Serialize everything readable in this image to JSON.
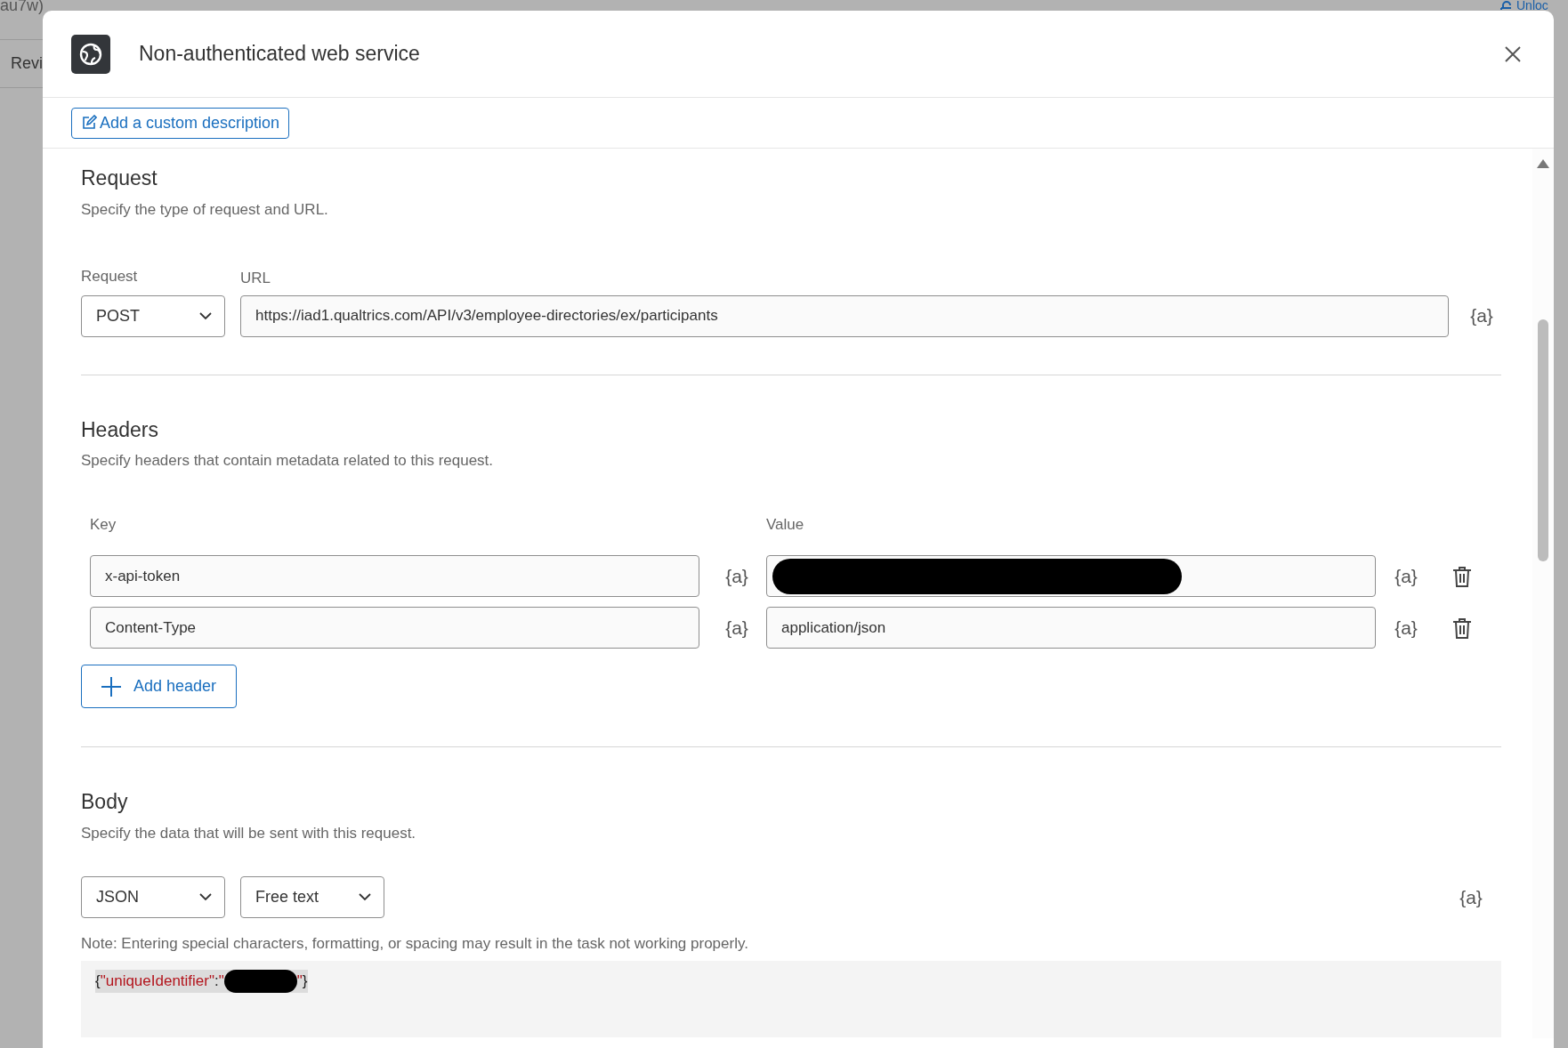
{
  "backdrop": {
    "top_left_text": "au7w)",
    "tab_text": "Revi",
    "unlock_text": "Unloc"
  },
  "dialog": {
    "title": "Non-authenticated web service",
    "description_button": "Add a custom description"
  },
  "request": {
    "heading": "Request",
    "subtitle": "Specify the type of request and URL.",
    "method_label": "Request",
    "method": "POST",
    "url_label": "URL",
    "url": "https://iad1.qualtrics.com/API/v3/employee-directories/ex/participants",
    "url_variable": "{a}"
  },
  "headers": {
    "heading": "Headers",
    "subtitle": "Specify headers that contain metadata related to this request.",
    "key_label": "Key",
    "value_label": "Value",
    "rows": [
      {
        "key": "x-api-token",
        "key_variable": "{a}",
        "value_redacted": true,
        "value_variable": "{a}"
      },
      {
        "key": "Content-Type",
        "key_variable": "{a}",
        "value": "application/json",
        "value_redacted": false,
        "value_variable": "{a}"
      }
    ],
    "add_button": "Add header"
  },
  "body": {
    "heading": "Body",
    "subtitle": "Specify the data that will be sent with this request.",
    "format": "JSON",
    "mode": "Free text",
    "body_variable": "{a}",
    "note": "Note: Entering special characters, formatting, or spacing may result in the task not working properly.",
    "content": [
      {
        "kind": "punct",
        "text": "{"
      },
      {
        "kind": "string",
        "text": "\"uniqueIdentifier\""
      },
      {
        "kind": "punct",
        "text": ":"
      },
      {
        "kind": "string",
        "text": "\""
      },
      {
        "kind": "redaction"
      },
      {
        "kind": "string",
        "text": "\""
      },
      {
        "kind": "punct",
        "text": "}"
      }
    ]
  }
}
